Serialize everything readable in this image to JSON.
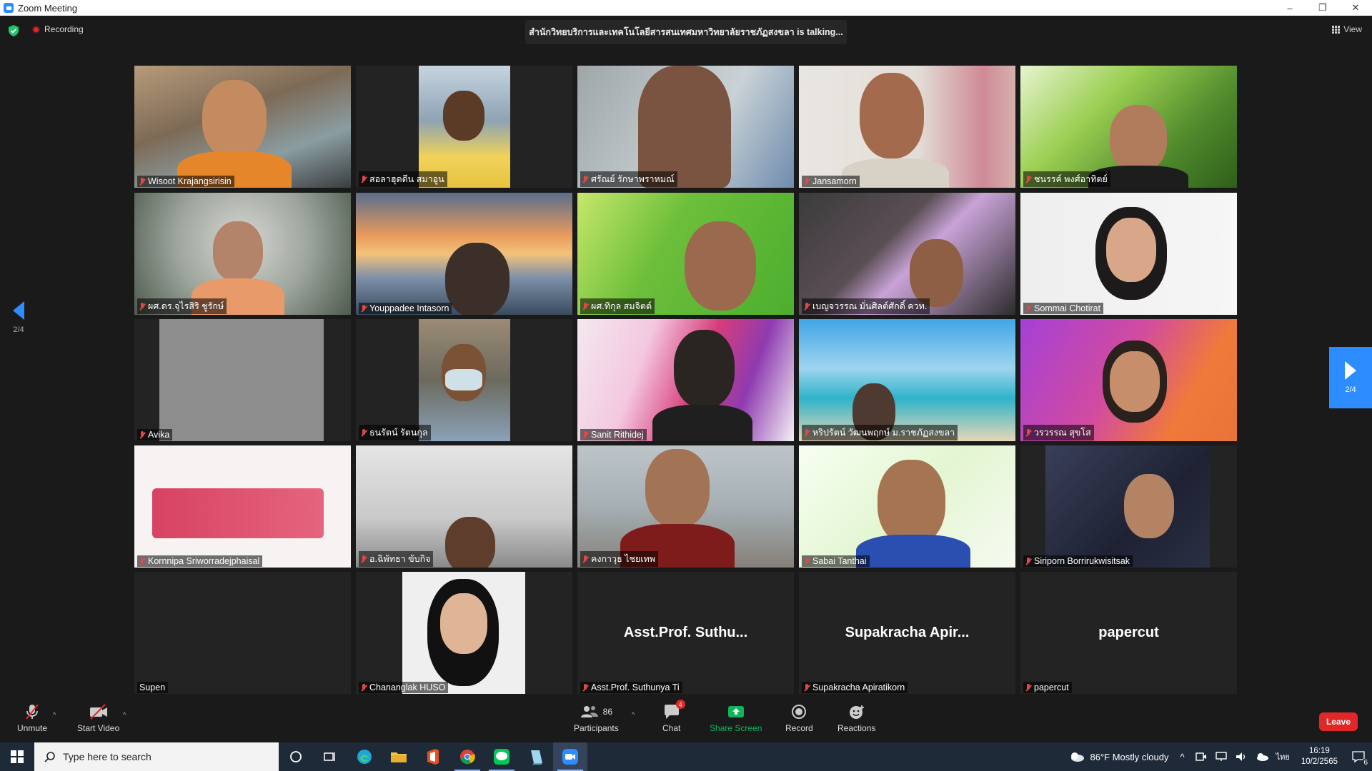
{
  "window": {
    "title": "Zoom Meeting",
    "minimize": "–",
    "restore": "❐",
    "close": "✕"
  },
  "meeting": {
    "recording_label": "Recording",
    "talking_banner": "สำนักวิทยบริการและเทคโนโลยีสารสนเทศมหาวิทยาลัยราชภัฏสงขลา is talking...",
    "view_label": "View",
    "page_indicator_left": "2/4",
    "page_indicator_right": "2/4"
  },
  "participants": [
    {
      "name": "Wisoot Krajangsirisin",
      "muted": true
    },
    {
      "name": "สอลาฮุดดีน สมาอูน",
      "muted": true
    },
    {
      "name": "ศรัณย์ รักษาพราหมณ์",
      "muted": true
    },
    {
      "name": "Jansamorn",
      "muted": true
    },
    {
      "name": "ชนรรค์ พงศ์อาทิตย์",
      "muted": true
    },
    {
      "name": "ผศ.ดร.จุไรสิริ ชูรักษ์",
      "muted": true
    },
    {
      "name": "Youppadee Intasorn",
      "muted": true
    },
    {
      "name": "ผศ.ทิกุล สมจิตต์",
      "muted": true
    },
    {
      "name": "เบญจวรรณ มั่นศิลต์ศักดิ์ ควท.",
      "muted": true
    },
    {
      "name": "Sommai Chotirat",
      "muted": true
    },
    {
      "name": "Avika",
      "muted": true
    },
    {
      "name": "ธนรัตน์ รัตนกุล",
      "muted": true
    },
    {
      "name": "Sanit Rithidej",
      "muted": true
    },
    {
      "name": "หริปรัตน์ วัฒนพฤกษ์ ม.ราชภัฏสงขลา",
      "muted": true
    },
    {
      "name": "วรวรรณ สุขโส",
      "muted": true
    },
    {
      "name": "Kornnipa Sriworradejphaisal",
      "muted": true
    },
    {
      "name": "อ.ฉิพัทธา ขับกิจ",
      "muted": true
    },
    {
      "name": "คงกาวุธ ไชยเทพ",
      "muted": true
    },
    {
      "name": "Sabai Tanthai",
      "muted": true
    },
    {
      "name": "Siriporn Borrirukwisitsak",
      "muted": true
    },
    {
      "name": "Supen",
      "muted": false
    },
    {
      "name": "Chananglak HUSO",
      "muted": true
    },
    {
      "name": "Asst.Prof. Suthunya Ti",
      "muted": true,
      "display": "Asst.Prof.  Suthu..."
    },
    {
      "name": "Supakracha Apiratikorn",
      "muted": true,
      "display": "Supakracha  Apir..."
    },
    {
      "name": "papercut",
      "muted": true,
      "display": "papercut"
    }
  ],
  "toolbar": {
    "unmute": "Unmute",
    "start_video": "Start Video",
    "participants": "Participants",
    "participants_count": "86",
    "chat": "Chat",
    "chat_badge": "4",
    "share_screen": "Share Screen",
    "record": "Record",
    "reactions": "Reactions",
    "leave": "Leave",
    "caret": "^"
  },
  "taskbar": {
    "search_placeholder": "Type here to search",
    "weather": "86°F  Mostly cloudy",
    "language": "ไทย",
    "time": "16:19",
    "date": "10/2/2565",
    "notification_count": "6"
  },
  "colors": {
    "accent": "#2d8cff",
    "leave": "#e02828",
    "share": "#0fb55b"
  }
}
